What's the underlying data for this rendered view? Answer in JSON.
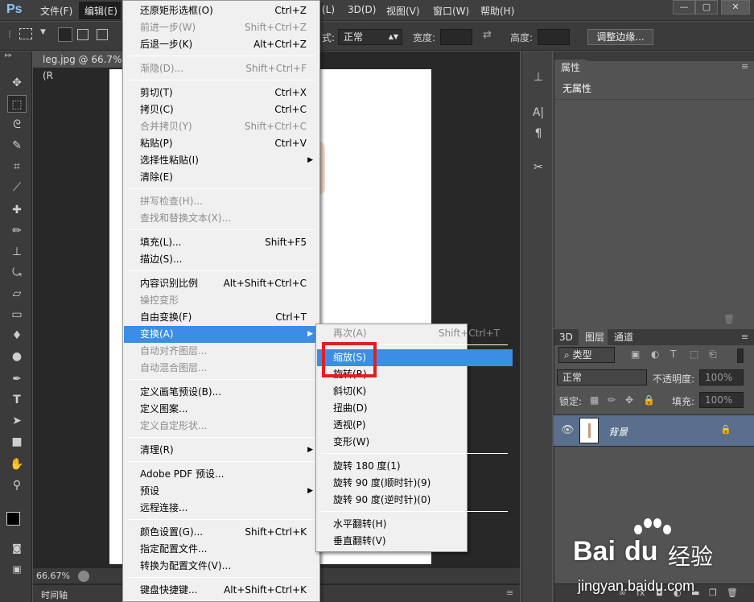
{
  "app": {
    "logo": "Ps"
  },
  "menubar": {
    "items": [
      "文件(F)",
      "编辑(E)",
      "图层(L)",
      "3D(D)",
      "视图(V)",
      "窗口(W)",
      "帮助(H)"
    ],
    "visible_right": [
      "(L)",
      "3D(D)",
      "视图(V)",
      "窗口(W)",
      "帮助(H)"
    ]
  },
  "options": {
    "style_label": "式:",
    "style_value": "正常",
    "width_label": "宽度:",
    "height_label": "高度:",
    "refine_button": "调整边缘..."
  },
  "document": {
    "tab_title": "leg.jpg @ 66.7%(R",
    "zoom": "66.67%"
  },
  "timeline": {
    "label": "时间轴"
  },
  "properties": {
    "tab": "属性",
    "content": "无属性"
  },
  "layers_panel": {
    "tabs": [
      "3D",
      "图层",
      "通道"
    ],
    "filter_kind": "类型",
    "blend_mode": "正常",
    "opacity_label": "不透明度:",
    "opacity_value": "100%",
    "lock_label": "锁定:",
    "fill_label": "填充:",
    "fill_value": "100%",
    "layer_name": "背景"
  },
  "edit_menu": [
    {
      "label": "还原矩形选框(O)",
      "shortcut": "Ctrl+Z",
      "disabled": false
    },
    {
      "label": "前进一步(W)",
      "shortcut": "Shift+Ctrl+Z",
      "disabled": true
    },
    {
      "label": "后退一步(K)",
      "shortcut": "Alt+Ctrl+Z",
      "disabled": false
    },
    {
      "sep": true
    },
    {
      "label": "渐隐(D)...",
      "shortcut": "Shift+Ctrl+F",
      "disabled": true
    },
    {
      "sep": true
    },
    {
      "label": "剪切(T)",
      "shortcut": "Ctrl+X",
      "disabled": false
    },
    {
      "label": "拷贝(C)",
      "shortcut": "Ctrl+C",
      "disabled": false
    },
    {
      "label": "合并拷贝(Y)",
      "shortcut": "Shift+Ctrl+C",
      "disabled": true
    },
    {
      "label": "粘贴(P)",
      "shortcut": "Ctrl+V",
      "disabled": false
    },
    {
      "label": "选择性粘贴(I)",
      "shortcut": "",
      "disabled": false,
      "submenu": true
    },
    {
      "label": "清除(E)",
      "shortcut": "",
      "disabled": false
    },
    {
      "sep": true
    },
    {
      "label": "拼写检查(H)...",
      "shortcut": "",
      "disabled": true
    },
    {
      "label": "查找和替换文本(X)...",
      "shortcut": "",
      "disabled": true
    },
    {
      "sep": true
    },
    {
      "label": "填充(L)...",
      "shortcut": "Shift+F5",
      "disabled": false
    },
    {
      "label": "描边(S)...",
      "shortcut": "",
      "disabled": false
    },
    {
      "sep": true
    },
    {
      "label": "内容识别比例",
      "shortcut": "Alt+Shift+Ctrl+C",
      "disabled": false
    },
    {
      "label": "操控变形",
      "shortcut": "",
      "disabled": true
    },
    {
      "label": "自由变换(F)",
      "shortcut": "Ctrl+T",
      "disabled": false
    },
    {
      "label": "变换(A)",
      "shortcut": "",
      "disabled": false,
      "submenu": true,
      "highlight": true
    },
    {
      "label": "自动对齐图层...",
      "shortcut": "",
      "disabled": true
    },
    {
      "label": "自动混合图层...",
      "shortcut": "",
      "disabled": true
    },
    {
      "sep": true
    },
    {
      "label": "定义画笔预设(B)...",
      "shortcut": "",
      "disabled": false
    },
    {
      "label": "定义图案...",
      "shortcut": "",
      "disabled": false
    },
    {
      "label": "定义自定形状...",
      "shortcut": "",
      "disabled": true
    },
    {
      "sep": true
    },
    {
      "label": "清理(R)",
      "shortcut": "",
      "disabled": false,
      "submenu": true
    },
    {
      "sep": true
    },
    {
      "label": "Adobe PDF 预设...",
      "shortcut": "",
      "disabled": false
    },
    {
      "label": "预设",
      "shortcut": "",
      "disabled": false,
      "submenu": true
    },
    {
      "label": "远程连接...",
      "shortcut": "",
      "disabled": false
    },
    {
      "sep": true
    },
    {
      "label": "颜色设置(G)...",
      "shortcut": "Shift+Ctrl+K",
      "disabled": false
    },
    {
      "label": "指定配置文件...",
      "shortcut": "",
      "disabled": false
    },
    {
      "label": "转换为配置文件(V)...",
      "shortcut": "",
      "disabled": false
    },
    {
      "sep": true
    },
    {
      "label": "键盘快捷键...",
      "shortcut": "Alt+Shift+Ctrl+K",
      "disabled": false
    }
  ],
  "transform_submenu": [
    {
      "label": "再次(A)",
      "shortcut": "Shift+Ctrl+T",
      "disabled": true
    },
    {
      "sep": true
    },
    {
      "label": "缩放(S)",
      "shortcut": "",
      "disabled": false,
      "highlight": true
    },
    {
      "label": "旋转(R)",
      "shortcut": "",
      "disabled": false
    },
    {
      "label": "斜切(K)",
      "shortcut": "",
      "disabled": false
    },
    {
      "label": "扭曲(D)",
      "shortcut": "",
      "disabled": false
    },
    {
      "label": "透视(P)",
      "shortcut": "",
      "disabled": false
    },
    {
      "label": "变形(W)",
      "shortcut": "",
      "disabled": false
    },
    {
      "sep": true
    },
    {
      "label": "旋转 180 度(1)",
      "shortcut": "",
      "disabled": false
    },
    {
      "label": "旋转 90 度(顺时针)(9)",
      "shortcut": "",
      "disabled": false
    },
    {
      "label": "旋转 90 度(逆时针)(0)",
      "shortcut": "",
      "disabled": false
    },
    {
      "sep": true
    },
    {
      "label": "水平翻转(H)",
      "shortcut": "",
      "disabled": false
    },
    {
      "label": "垂直翻转(V)",
      "shortcut": "",
      "disabled": false
    }
  ],
  "watermark": {
    "brand": "Bai",
    "brand2": "du",
    "brand_cn": "经验",
    "url": "jingyan.baidu.com"
  }
}
